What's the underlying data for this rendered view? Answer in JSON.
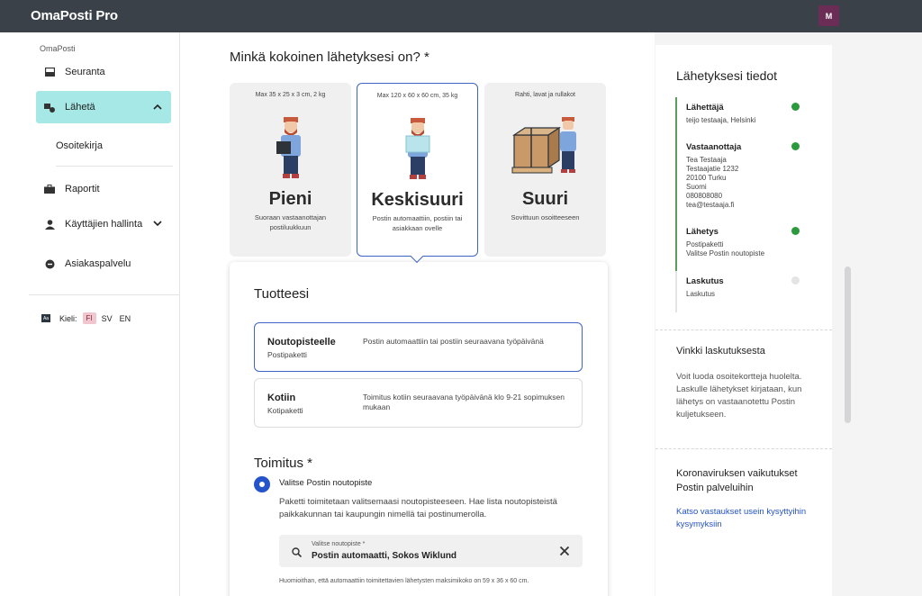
{
  "app": {
    "brand": "OmaPosti Pro",
    "user_initial": "M"
  },
  "sidebar": {
    "section_label": "OmaPosti",
    "items": [
      {
        "label": "Seuranta",
        "icon": "inbox-icon"
      },
      {
        "label": "Lähetä",
        "icon": "send-package-icon",
        "active": true
      },
      {
        "label": "Raportit",
        "icon": "briefcase-icon"
      },
      {
        "label": "Käyttäjien hallinta",
        "icon": "person-icon"
      },
      {
        "label": "Asiakaspalvelu",
        "icon": "chat-icon"
      }
    ],
    "subitem": "Osoitekirja",
    "language": {
      "label": "Kieli:",
      "options": [
        "FI",
        "SV",
        "EN"
      ],
      "selected": "FI"
    }
  },
  "main": {
    "question": "Minkä kokoinen lähetyksesi on? *",
    "sizes": [
      {
        "dims": "Max 35 x 25 x 3 cm, 2 kg",
        "name": "Pieni",
        "desc": "Suoraan vastaanottajan postiluukkuun"
      },
      {
        "dims": "Max 120 x 60 x 60 cm, 35 kg",
        "name": "Keskisuuri",
        "desc": "Postin automaattiin, postiin tai asiakkaan ovelle",
        "selected": true
      },
      {
        "dims": "Rahti, lavat ja rullakot",
        "name": "Suuri",
        "desc": "Sovittuun osoitteeseen"
      }
    ],
    "products_title": "Tuotteesi",
    "products": [
      {
        "name": "Noutopisteelle",
        "sub": "Postipaketti",
        "desc": "Postin automaattiin tai postiin seuraavana työpäivänä",
        "selected": true
      },
      {
        "name": "Kotiin",
        "sub": "Kotipaketti",
        "desc": "Toimitus kotiin seuraavana työpäivänä klo 9-21 sopimuksen mukaan"
      }
    ],
    "delivery_title": "Toimitus *",
    "delivery_option": "Valitse Postin noutopiste",
    "delivery_desc": "Paketti toimitetaan valitsemaasi noutopisteeseen. Hae lista noutopisteistä paikkakunnan tai kaupungin nimellä tai postinumerolla.",
    "pickup_label": "Valitse noutopiste *",
    "pickup_value": "Postin automaatti, Sokos Wiklund",
    "note": "Huomioithan, että automaattiin toimitettavien lähetysten maksimikoko on 59 x 36 x 60 cm."
  },
  "summary": {
    "title": "Lähetyksesi tiedot",
    "steps": [
      {
        "title": "Lähettäjä",
        "value": "teijo testaaja, Helsinki",
        "done": true
      },
      {
        "title": "Vastaanottaja",
        "value": "Tea Testaaja\nTestaajatie 1232\n20100 Turku\nSuomi\n080808080\ntea@testaaja.fi",
        "done": true
      },
      {
        "title": "Lähetys",
        "value": "Postipaketti\nValitse Postin noutopiste",
        "done": true
      },
      {
        "title": "Laskutus",
        "value": "Laskutus",
        "done": false
      }
    ]
  },
  "tips": [
    {
      "title": "Vinkki laskutuksesta",
      "text": "Voit luoda osoitekortteja huolelta. Laskulle lähetykset kirjataan, kun lähetys on vastaanotettu Postin kuljetukseen."
    },
    {
      "title": "Koronaviruksen vaikutukset Postin palveluihin",
      "link": "Katso vastaukset usein kysyttyihin kysymyksiin"
    }
  ],
  "colors": {
    "topbar": "#3a4148",
    "accent": "#2553c9",
    "active_nav": "#a5e8e6",
    "done": "#2a9a3c"
  }
}
